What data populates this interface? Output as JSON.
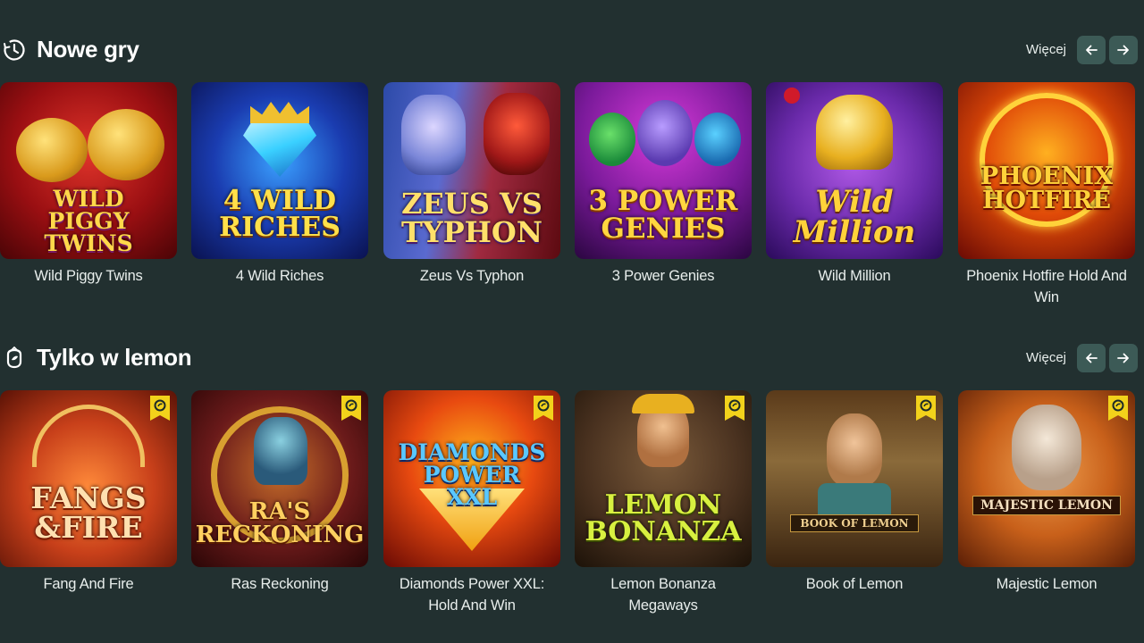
{
  "sections": [
    {
      "title": "Nowe gry",
      "icon": "clock-icon",
      "more": "Więcej",
      "games": [
        {
          "name": "Wild Piggy Twins",
          "art_title": "WILD\nPIGGY TWINS"
        },
        {
          "name": "4 Wild Riches",
          "art_title": "4 WILD\nRICHES"
        },
        {
          "name": "Zeus Vs Typhon",
          "art_title": "ZEUS VS\nTYPHON"
        },
        {
          "name": "3 Power Genies",
          "art_title": "3 POWER\nGENIES"
        },
        {
          "name": "Wild Million",
          "art_title": "Wild\nMillion"
        },
        {
          "name": "Phoenix Hotfire Hold And Win",
          "art_title": "PHOENIX\nHOTFIRE"
        }
      ]
    },
    {
      "title": "Tylko w lemon",
      "icon": "lemon-icon",
      "more": "Więcej",
      "games": [
        {
          "name": "Fang And Fire",
          "art_title": "FANGS\n&FIRE"
        },
        {
          "name": "Ras Reckoning",
          "art_title": "RA'S\nRECKONING"
        },
        {
          "name": "Diamonds Power XXL: Hold And Win",
          "art_title": "DIAMONDS\nPOWER\nXXL"
        },
        {
          "name": "Lemon Bonanza Megaways",
          "art_title": "LEMON\nBONANZA"
        },
        {
          "name": "Book of Lemon",
          "art_title": "BOOK OF LEMON"
        },
        {
          "name": "Majestic Lemon",
          "art_title": "MAJESTIC LEMON"
        }
      ]
    }
  ],
  "colors": {
    "background": "#223030",
    "button": "#3c5a56",
    "badge": "#f2d21b"
  }
}
